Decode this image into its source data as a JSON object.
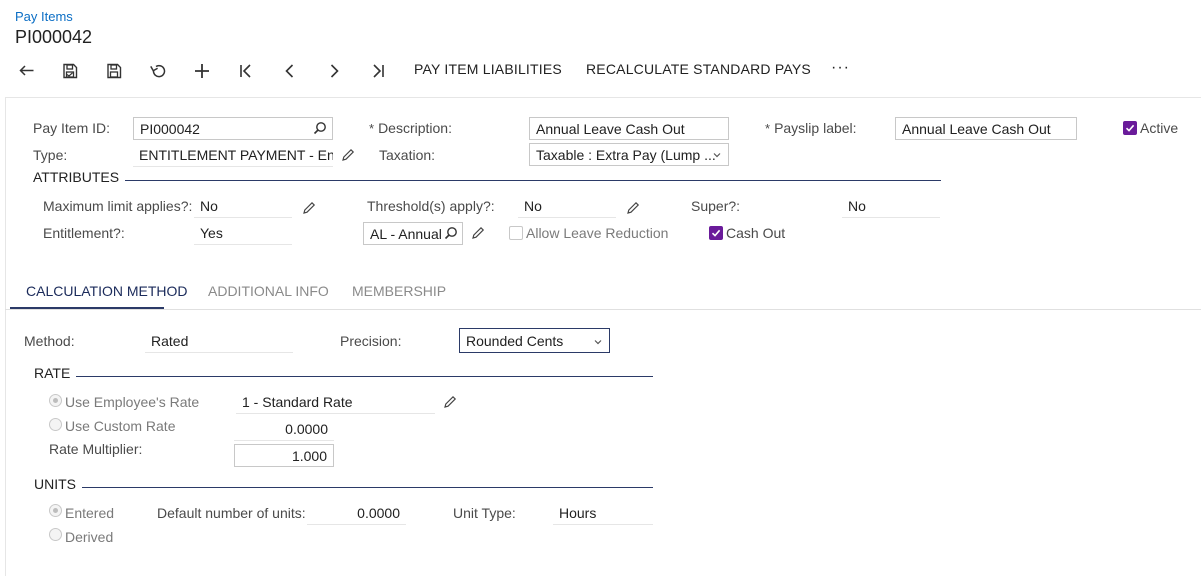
{
  "header": {
    "breadcrumb": "Pay Items",
    "title": "PI000042"
  },
  "toolbar": {
    "liabilities_label": "PAY ITEM LIABILITIES",
    "recalculate_label": "RECALCULATE STANDARD PAYS",
    "more_label": "···"
  },
  "form": {
    "pay_item_id_label": "Pay Item ID:",
    "pay_item_id_value": "PI000042",
    "type_label": "Type:",
    "type_value": "ENTITLEMENT PAYMENT - Enti",
    "description_label": "Description:",
    "description_value": "Annual Leave Cash Out",
    "taxation_label": "Taxation:",
    "taxation_value": "Taxable : Extra Pay (Lump ...",
    "payslip_label_label": "Payslip label:",
    "payslip_label_value": "Annual Leave Cash Out",
    "active_label": "Active",
    "required_mark": "*"
  },
  "attributes": {
    "title": "ATTRIBUTES",
    "max_limit_label": "Maximum limit applies?:",
    "max_limit_value": "No",
    "threshold_label": "Threshold(s) apply?:",
    "threshold_value": "No",
    "super_label": "Super?:",
    "super_value": "No",
    "entitlement_label": "Entitlement?:",
    "entitlement_value": "Yes",
    "leave_value": "AL - Annual",
    "allow_leave_reduction_label": "Allow Leave Reduction",
    "cash_out_label": "Cash Out"
  },
  "tabs": [
    {
      "label": "CALCULATION METHOD"
    },
    {
      "label": "ADDITIONAL INFO"
    },
    {
      "label": "MEMBERSHIP"
    }
  ],
  "calc": {
    "method_label": "Method:",
    "method_value": "Rated",
    "precision_label": "Precision:",
    "precision_value": "Rounded Cents"
  },
  "rate": {
    "title": "RATE",
    "use_employee_rate_label": "Use Employee's Rate",
    "employee_rate_value": "1 - Standard Rate",
    "use_custom_rate_label": "Use Custom Rate",
    "custom_rate_value": "0.0000",
    "multiplier_label": "Rate Multiplier:",
    "multiplier_value": "1.000"
  },
  "units": {
    "title": "UNITS",
    "entered_label": "Entered",
    "derived_label": "Derived",
    "default_units_label": "Default number of units:",
    "default_units_value": "0.0000",
    "unit_type_label": "Unit Type:",
    "unit_type_value": "Hours"
  },
  "colors": {
    "accent_purple": "#6a1b9a",
    "link_blue": "#0b6ec5",
    "section_line": "#2b3a67"
  }
}
